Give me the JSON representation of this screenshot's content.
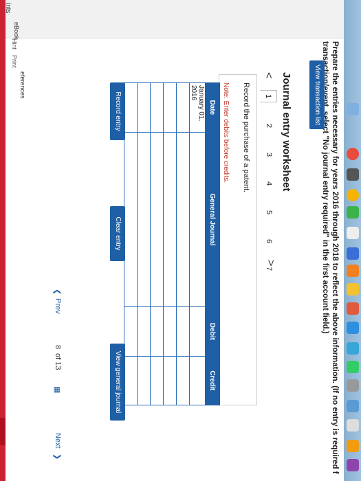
{
  "header": {
    "instruction_line1": "Prepare the entries necessary for years 2016 through 2018 to reflect the above information. (If no entry is required f",
    "instruction_line2": "transaction/event, select \"No journal entry required\" in the first account field.)"
  },
  "sidebar": {
    "points_label": "ints",
    "items": [
      {
        "label": "eBook"
      },
      {
        "label": "Hint"
      },
      {
        "label": "Print"
      },
      {
        "label": "eferences"
      }
    ]
  },
  "view_transaction_list": "View transaction list",
  "worksheet": {
    "title": "Journal entry worksheet",
    "steps": [
      "1",
      "2",
      "3",
      "4",
      "5",
      "6",
      "7"
    ],
    "active_step": "1",
    "prev_symbol": "<",
    "next_symbol": ">",
    "description": "Record the purchase of a patent.",
    "note": "Note: Enter debits before credits.",
    "columns": [
      "Date",
      "General Journal",
      "Debit",
      "Credit"
    ],
    "rows": [
      [
        "January 01, 2016",
        "",
        "",
        ""
      ],
      [
        "",
        "",
        "",
        ""
      ],
      [
        "",
        "",
        "",
        ""
      ],
      [
        "",
        "",
        "",
        ""
      ],
      [
        "",
        "",
        "",
        ""
      ],
      [
        "",
        "",
        "",
        ""
      ]
    ]
  },
  "buttons": {
    "record_entry": "Record entry",
    "clear_entry": "Clear entry",
    "view_general_journal": "View general journal"
  },
  "pagination": {
    "prev": "Prev",
    "page_current": "8",
    "page_of": "of 13",
    "next": "Next"
  }
}
